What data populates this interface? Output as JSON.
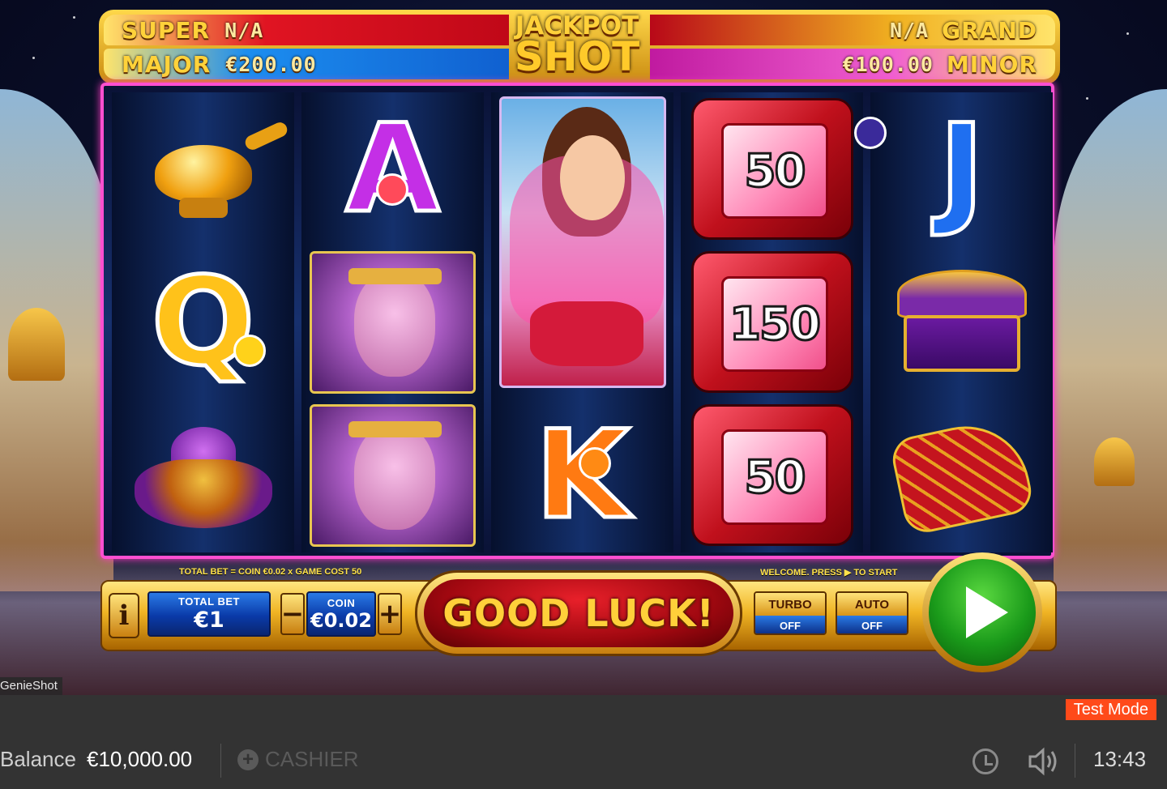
{
  "jackpots": {
    "logo_line1": "JACKPOT",
    "logo_line2": "SHOT",
    "super_label": "SUPER",
    "super_value": "N/A",
    "grand_label": "GRAND",
    "grand_value": "N/A",
    "major_label": "MAJOR",
    "major_value": "€200.00",
    "minor_label": "MINOR",
    "minor_value": "€100.00"
  },
  "reels": [
    [
      {
        "symbol": "magic-lamp"
      },
      {
        "symbol": "Q",
        "fruit": "lemon"
      },
      {
        "symbol": "jeweled-turban"
      }
    ],
    [
      {
        "symbol": "A",
        "fruit": "watermelon"
      },
      {
        "symbol": "genie"
      },
      {
        "symbol": "genie"
      }
    ],
    [
      {
        "symbol": "princess"
      },
      {
        "symbol": "K",
        "fruit": "orange"
      }
    ],
    [
      {
        "symbol": "ruby-gem",
        "value": "50"
      },
      {
        "symbol": "ruby-gem",
        "value": "150"
      },
      {
        "symbol": "ruby-gem",
        "value": "50"
      }
    ],
    [
      {
        "symbol": "J",
        "fruit": "plum"
      },
      {
        "symbol": "treasure-chest"
      },
      {
        "symbol": "magic-carpet"
      }
    ]
  ],
  "reel_labels": {
    "r1c2": "Q",
    "r2c1": "A",
    "r3c2": "K",
    "r4c1": "50",
    "r4c2": "150",
    "r4c3": "50",
    "r5c1": "J"
  },
  "controls": {
    "bet_info": "TOTAL BET = COIN €0.02 x GAME COST 50",
    "welcome_info": "WELCOME. PRESS ▶ TO START",
    "info_button": "i",
    "total_bet_label": "TOTAL BET",
    "total_bet_value": "€1",
    "coin_label": "COIN",
    "coin_value": "€0.02",
    "minus": "−",
    "plus": "+",
    "message": "GOOD LUCK!",
    "turbo_label": "TURBO",
    "turbo_state": "OFF",
    "auto_label": "AUTO",
    "auto_state": "OFF"
  },
  "footer": {
    "game_name": "GenieShot",
    "test_mode": "Test Mode",
    "balance_label": "Balance",
    "balance_value": "€10,000.00",
    "cashier": "CASHIER",
    "clock": "13:43"
  },
  "colors": {
    "reel_border": "#ff4fd0",
    "gold": "#f0b424",
    "spin_green": "#1a9a1a",
    "test_mode_bg": "#ff4a1a"
  }
}
